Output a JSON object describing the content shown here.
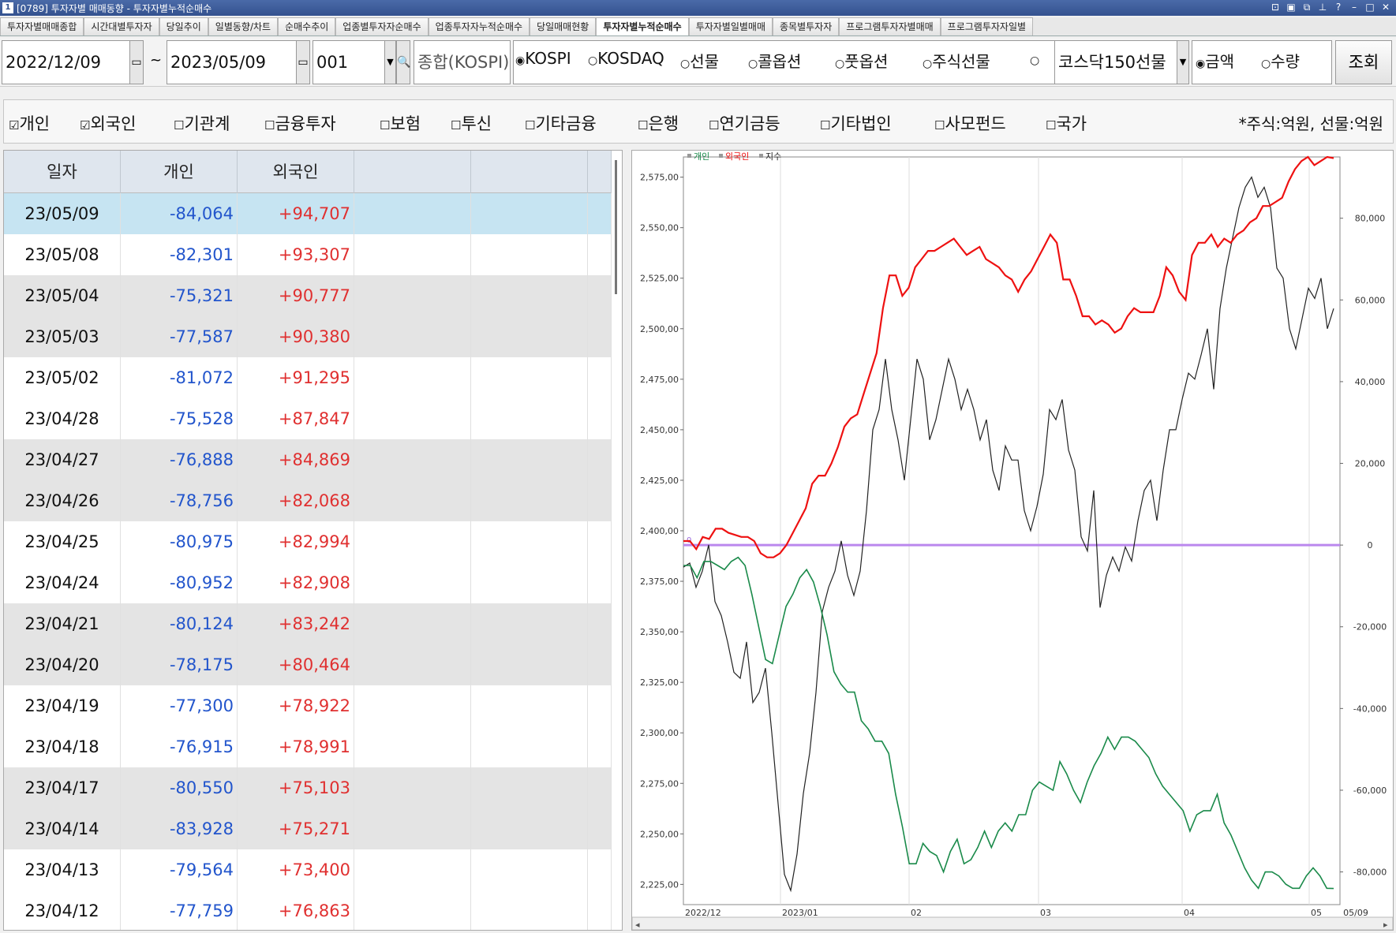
{
  "window": {
    "title": "[0789] 투자자별 매매동향 - 투자자별누적순매수",
    "icon_label": "1"
  },
  "tabs": [
    "투자자별매매종합",
    "시간대별투자자",
    "당일추이",
    "일별동향/차트",
    "순매수추이",
    "업종별투자자순매수",
    "업종투자자누적순매수",
    "당일매매현황",
    "투자자별누적순매수",
    "투자자별일별매매",
    "종목별투자자",
    "프로그램투자자별매매",
    "프로그램투자자일별"
  ],
  "active_tab": 8,
  "toolbar": {
    "start_date": "2022/12/09",
    "tilde": "~",
    "end_date": "2023/05/09",
    "code": "001",
    "market_name": "종합(KOSPI)",
    "markets": [
      "KOSPI",
      "KOSDAQ",
      "선물",
      "콜옵션",
      "풋옵션",
      "주식선물",
      ""
    ],
    "selected_market": 0,
    "product": "코스닥150선물",
    "units": [
      "금액",
      "수량"
    ],
    "selected_unit": 0,
    "search_label": "조회"
  },
  "filters": {
    "items": [
      "개인",
      "외국인",
      "기관계",
      "금융투자",
      "보험",
      "투신",
      "기타금융",
      "은행",
      "연기금등",
      "기타법인",
      "사모펀드",
      "국가"
    ],
    "checked": [
      true,
      true,
      false,
      false,
      false,
      false,
      false,
      false,
      false,
      false,
      false,
      false
    ],
    "unit_note": "*주식:억원, 선물:억원"
  },
  "grid": {
    "headers": [
      "일자",
      "개인",
      "외국인",
      "",
      "",
      ""
    ],
    "rows": [
      {
        "date": "23/05/09",
        "individual": "-84,064",
        "foreign": "+94,707"
      },
      {
        "date": "23/05/08",
        "individual": "-82,301",
        "foreign": "+93,307"
      },
      {
        "date": "23/05/04",
        "individual": "-75,321",
        "foreign": "+90,777"
      },
      {
        "date": "23/05/03",
        "individual": "-77,587",
        "foreign": "+90,380"
      },
      {
        "date": "23/05/02",
        "individual": "-81,072",
        "foreign": "+91,295"
      },
      {
        "date": "23/04/28",
        "individual": "-75,528",
        "foreign": "+87,847"
      },
      {
        "date": "23/04/27",
        "individual": "-76,888",
        "foreign": "+84,869"
      },
      {
        "date": "23/04/26",
        "individual": "-78,756",
        "foreign": "+82,068"
      },
      {
        "date": "23/04/25",
        "individual": "-80,975",
        "foreign": "+82,994"
      },
      {
        "date": "23/04/24",
        "individual": "-80,952",
        "foreign": "+82,908"
      },
      {
        "date": "23/04/21",
        "individual": "-80,124",
        "foreign": "+83,242"
      },
      {
        "date": "23/04/20",
        "individual": "-78,175",
        "foreign": "+80,464"
      },
      {
        "date": "23/04/19",
        "individual": "-77,300",
        "foreign": "+78,922"
      },
      {
        "date": "23/04/18",
        "individual": "-76,915",
        "foreign": "+78,991"
      },
      {
        "date": "23/04/17",
        "individual": "-80,550",
        "foreign": "+75,103"
      },
      {
        "date": "23/04/14",
        "individual": "-83,928",
        "foreign": "+75,271"
      },
      {
        "date": "23/04/13",
        "individual": "-79,564",
        "foreign": "+73,400"
      },
      {
        "date": "23/04/12",
        "individual": "-77,759",
        "foreign": "+76,863"
      }
    ],
    "selected_row": 0
  },
  "colors": {
    "individual": "#1a8a4a",
    "foreign": "#ee1111",
    "index": "#222222",
    "zero_line": "#bb88ee",
    "selected_row": "#c6e4f2",
    "shaded_row": "#e4e4e4"
  },
  "chart_data": {
    "type": "line",
    "legend": [
      "개인",
      "외국인",
      "지수"
    ],
    "x_labels": [
      "2022/12",
      "2023/01",
      "02",
      "03",
      "04",
      "05",
      "05/09"
    ],
    "y_left_ticks": [
      "2,575,00",
      "2,550,00",
      "2,525,00",
      "2,500,00",
      "2,475,00",
      "2,450,00",
      "2,425,00",
      "2,400,00",
      "2,375,00",
      "2,350,00",
      "2,325,00",
      "2,300,00",
      "2,275,00",
      "2,250,00",
      "2,225,00"
    ],
    "y_left_range": [
      2215,
      2585
    ],
    "y_right_ticks": [
      "80,000",
      "60,000",
      "40,000",
      "20,000",
      "0",
      "-20,000",
      "-40,000",
      "-60,000",
      "-80,000"
    ],
    "y_right_range": [
      -88000,
      95000
    ],
    "zero_label": "0",
    "series": [
      {
        "name": "지수",
        "axis": "left",
        "values": [
          2382,
          2384,
          2372,
          2380,
          2393,
          2365,
          2358,
          2345,
          2330,
          2327,
          2345,
          2315,
          2320,
          2332,
          2300,
          2265,
          2230,
          2222,
          2240,
          2270,
          2290,
          2320,
          2360,
          2372,
          2380,
          2395,
          2378,
          2368,
          2380,
          2410,
          2450,
          2460,
          2485,
          2460,
          2445,
          2425,
          2455,
          2485,
          2475,
          2445,
          2455,
          2470,
          2485,
          2475,
          2460,
          2470,
          2460,
          2445,
          2455,
          2430,
          2420,
          2442,
          2435,
          2435,
          2410,
          2400,
          2412,
          2428,
          2460,
          2455,
          2465,
          2440,
          2430,
          2397,
          2390,
          2420,
          2362,
          2378,
          2387,
          2380,
          2392,
          2385,
          2405,
          2420,
          2425,
          2405,
          2430,
          2450,
          2450,
          2465,
          2478,
          2475,
          2487,
          2500,
          2470,
          2510,
          2530,
          2545,
          2560,
          2570,
          2575,
          2565,
          2570,
          2560,
          2530,
          2525,
          2500,
          2490,
          2505,
          2520,
          2515,
          2525,
          2500,
          2510
        ]
      },
      {
        "name": "외국인",
        "axis": "right",
        "values": [
          1000,
          1000,
          -1000,
          2000,
          1500,
          4000,
          4000,
          3000,
          2500,
          2000,
          2000,
          1000,
          -2000,
          -3000,
          -3000,
          -2000,
          0,
          3000,
          6000,
          9000,
          15000,
          17000,
          17000,
          20000,
          24000,
          29000,
          31000,
          32000,
          37000,
          42000,
          47000,
          58000,
          66000,
          66000,
          61000,
          63000,
          68000,
          70000,
          72000,
          72000,
          73000,
          74000,
          75000,
          73000,
          71000,
          72000,
          73000,
          70000,
          69000,
          68000,
          66000,
          65000,
          62000,
          65000,
          67000,
          70000,
          73000,
          76000,
          74000,
          65000,
          65000,
          61000,
          56000,
          56000,
          54000,
          55000,
          54000,
          52000,
          53000,
          56000,
          58000,
          57000,
          57000,
          57000,
          61000,
          68000,
          66000,
          62000,
          60000,
          71000,
          74000,
          74000,
          76000,
          73000,
          75000,
          74000,
          76000,
          77000,
          79000,
          80000,
          83000,
          83000,
          84000,
          85000,
          89000,
          92000,
          94000,
          95000,
          93000,
          94000,
          95000,
          94707
        ]
      },
      {
        "name": "개인",
        "axis": "right",
        "values": [
          -5000,
          -5000,
          -8000,
          -4000,
          -4000,
          -5000,
          -6000,
          -4000,
          -3000,
          -5000,
          -12000,
          -20000,
          -28000,
          -29000,
          -22000,
          -15000,
          -12000,
          -8000,
          -6000,
          -9000,
          -15000,
          -22000,
          -31000,
          -34000,
          -36000,
          -36000,
          -43000,
          -45000,
          -48000,
          -48000,
          -51000,
          -61000,
          -69000,
          -78000,
          -78000,
          -73000,
          -75000,
          -76000,
          -80000,
          -75000,
          -72000,
          -78000,
          -77000,
          -74000,
          -70000,
          -74000,
          -70000,
          -68000,
          -70000,
          -66000,
          -66000,
          -60000,
          -58000,
          -59000,
          -60000,
          -53000,
          -56000,
          -60000,
          -63000,
          -58000,
          -54000,
          -51000,
          -47000,
          -50000,
          -47000,
          -47000,
          -48000,
          -50000,
          -52000,
          -56000,
          -59000,
          -61000,
          -63000,
          -65000,
          -70000,
          -66000,
          -65000,
          -65000,
          -61000,
          -68000,
          -71000,
          -75000,
          -79000,
          -82000,
          -84000,
          -80000,
          -80000,
          -81000,
          -83000,
          -84000,
          -84000,
          -81000,
          -79000,
          -81000,
          -84000,
          -84064
        ]
      }
    ]
  }
}
